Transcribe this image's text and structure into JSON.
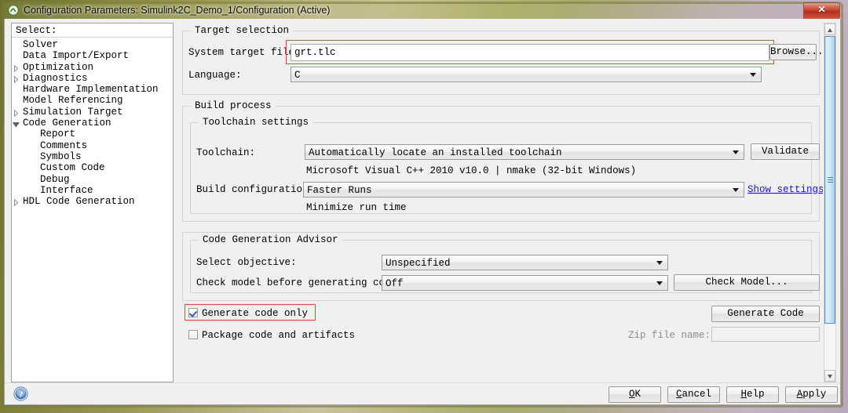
{
  "window": {
    "title": "Configuration Parameters: Simulink2C_Demo_1/Configuration (Active)",
    "app_icon": "simulink-icon",
    "close_label": "Close"
  },
  "sidebar": {
    "header": "Select:",
    "items": [
      {
        "label": "Solver",
        "indent": 1,
        "twisty": "none",
        "selected": false
      },
      {
        "label": "Data Import/Export",
        "indent": 1,
        "twisty": "none",
        "selected": false
      },
      {
        "label": "Optimization",
        "indent": 1,
        "twisty": "collapsed",
        "selected": false
      },
      {
        "label": "Diagnostics",
        "indent": 1,
        "twisty": "collapsed",
        "selected": false
      },
      {
        "label": "Hardware Implementation",
        "indent": 1,
        "twisty": "none",
        "selected": false
      },
      {
        "label": "Model Referencing",
        "indent": 1,
        "twisty": "none",
        "selected": false
      },
      {
        "label": "Simulation Target",
        "indent": 1,
        "twisty": "collapsed",
        "selected": false
      },
      {
        "label": "Code Generation",
        "indent": 1,
        "twisty": "expanded",
        "selected": false
      },
      {
        "label": "Report",
        "indent": 2,
        "twisty": "none",
        "selected": false
      },
      {
        "label": "Comments",
        "indent": 2,
        "twisty": "none",
        "selected": false
      },
      {
        "label": "Symbols",
        "indent": 2,
        "twisty": "none",
        "selected": false
      },
      {
        "label": "Custom Code",
        "indent": 2,
        "twisty": "none",
        "selected": false
      },
      {
        "label": "Debug",
        "indent": 2,
        "twisty": "none",
        "selected": false
      },
      {
        "label": "Interface",
        "indent": 2,
        "twisty": "none",
        "selected": false
      },
      {
        "label": "HDL Code Generation",
        "indent": 1,
        "twisty": "collapsed",
        "selected": false
      }
    ]
  },
  "target_selection": {
    "group_title": "Target selection",
    "system_target_file_label": "System target file:",
    "system_target_file_value": "grt.tlc",
    "browse_label": "Browse...",
    "language_label": "Language:",
    "language_value": "C"
  },
  "build_process": {
    "group_title": "Build process",
    "toolchain_group_title": "Toolchain settings",
    "toolchain_label": "Toolchain:",
    "toolchain_value": "Automatically locate an installed toolchain",
    "toolchain_info": "Microsoft Visual C++ 2010 v10.0 | nmake (32-bit Windows)",
    "validate_label": "Validate",
    "build_configuration_label": "Build configuration:",
    "build_configuration_value": "Faster Runs",
    "build_configuration_info": "Minimize run time",
    "show_settings_label": "Show settings"
  },
  "code_generation_advisor": {
    "group_title": "Code Generation Advisor",
    "select_objective_label": "Select objective:",
    "select_objective_value": "Unspecified",
    "check_model_label": "Check model before generating code:",
    "check_model_value": "Off",
    "check_model_button": "Check Model..."
  },
  "actions": {
    "generate_code_only_label": "Generate code only",
    "generate_code_only_checked": true,
    "package_code_label": "Package code and artifacts",
    "package_code_checked": false,
    "generate_code_button": "Generate Code",
    "zip_file_name_label": "Zip file name:",
    "zip_file_name_value": ""
  },
  "footer": {
    "help_icon": "help-circle-icon",
    "buttons": [
      {
        "label": "OK",
        "mnemonic_index": 0
      },
      {
        "label": "Cancel",
        "mnemonic_index": 0
      },
      {
        "label": "Help",
        "mnemonic_index": 0
      },
      {
        "label": "Apply",
        "mnemonic_index": 0
      }
    ]
  },
  "colors": {
    "highlight_red": "#f0453c",
    "link_blue": "#1414d2",
    "scrollbar_thumb": "#bfe0f5",
    "panel_bg": "#f0f0f0"
  }
}
